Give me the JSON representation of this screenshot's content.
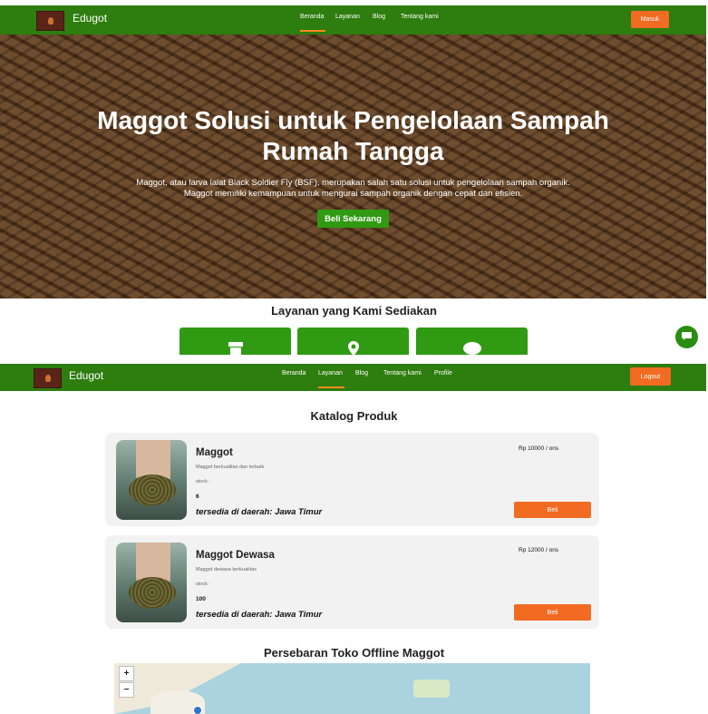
{
  "page1": {
    "nav": {
      "brand": "Edugot",
      "links": [
        "Beranda",
        "Layanan",
        "Blog",
        "Tentang kami"
      ],
      "active_link": "Beranda",
      "login_label": "Masuk"
    },
    "hero": {
      "title": "Maggot Solusi untuk Pengelolaan Sampah Rumah Tangga",
      "description": "Maggot, atau larva lalat Black Soldier Fly (BSF), merupakan salah satu solusi untuk pengelolaan sampah organik. Maggot memiliki kemampuan untuk mengurai sampah organik dengan cepat dan efisien.",
      "cta_label": "Beli Sekarang"
    },
    "services": {
      "title": "Layanan yang Kami Sediakan",
      "cards": [
        {
          "icon": "store-icon",
          "glyph": "▬"
        },
        {
          "icon": "location-pin-icon",
          "glyph": "⬤"
        },
        {
          "icon": "chat-bubble-icon",
          "glyph": "●"
        }
      ]
    },
    "chat_fab_icon": "chat-icon"
  },
  "page2": {
    "nav": {
      "brand": "Edugot",
      "links": [
        "Beranda",
        "Layanan",
        "Blog",
        "Tentang kami",
        "Profile"
      ],
      "active_link": "Layanan",
      "logout_label": "Logout"
    },
    "catalog": {
      "title": "Katalog Produk",
      "products": [
        {
          "name": "Maggot",
          "description": "Maggot berkualitas dan terbaik",
          "stock_label": "stock :",
          "stock_value": "6",
          "area": "tersedia di daerah: Jawa Timur",
          "price": "Rp 10000 / ons",
          "buy_label": "Beli"
        },
        {
          "name": "Maggot Dewasa",
          "description": "Maggot dewasa berkualitas",
          "stock_label": "stock :",
          "stock_value": "100",
          "area": "tersedia di daerah: Jawa Timur",
          "price": "Rp 12000 / ons",
          "buy_label": "Beli"
        }
      ]
    },
    "map_section": {
      "title": "Persebaran Toko Offline Maggot",
      "zoom_in": "+",
      "zoom_out": "−"
    }
  },
  "colors": {
    "nav_green": "#2e7d0f",
    "button_green": "#2f9a12",
    "accent_orange": "#f26b22",
    "card_bg": "#f2f2f2"
  }
}
